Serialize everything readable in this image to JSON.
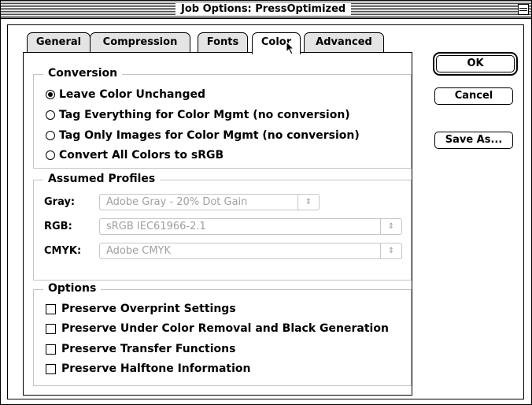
{
  "window": {
    "title": "Job Options: PressOptimized"
  },
  "tabs": [
    {
      "label": "General",
      "active": false
    },
    {
      "label": "Compression",
      "active": false
    },
    {
      "label": "Fonts",
      "active": false
    },
    {
      "label": "Color",
      "active": true
    },
    {
      "label": "Advanced",
      "active": false
    }
  ],
  "conversion": {
    "title": "Conversion",
    "options": [
      {
        "label": "Leave Color Unchanged",
        "selected": true
      },
      {
        "label": "Tag Everything for Color Mgmt (no conversion)",
        "selected": false
      },
      {
        "label": "Tag Only Images for Color Mgmt (no conversion)",
        "selected": false
      },
      {
        "label": "Convert All Colors to sRGB",
        "selected": false
      }
    ]
  },
  "profiles": {
    "title": "Assumed Profiles",
    "gray": {
      "label": "Gray:",
      "value": "Adobe Gray - 20% Dot Gain"
    },
    "rgb": {
      "label": "RGB:",
      "value": "sRGB IEC61966-2.1"
    },
    "cmyk": {
      "label": "CMYK:",
      "value": "Adobe CMYK"
    },
    "arrow_glyph": "⇕"
  },
  "options": {
    "title": "Options",
    "items": [
      {
        "label": "Preserve Overprint Settings",
        "checked": false
      },
      {
        "label": "Preserve Under Color Removal and Black Generation",
        "checked": false
      },
      {
        "label": "Preserve Transfer Functions",
        "checked": false
      },
      {
        "label": "Preserve Halftone Information",
        "checked": false
      }
    ]
  },
  "buttons": {
    "ok": "OK",
    "cancel": "Cancel",
    "save_as": "Save As..."
  },
  "icons": {
    "cursor": "arrow-cursor-icon",
    "zoom": "window-zoom-icon"
  }
}
